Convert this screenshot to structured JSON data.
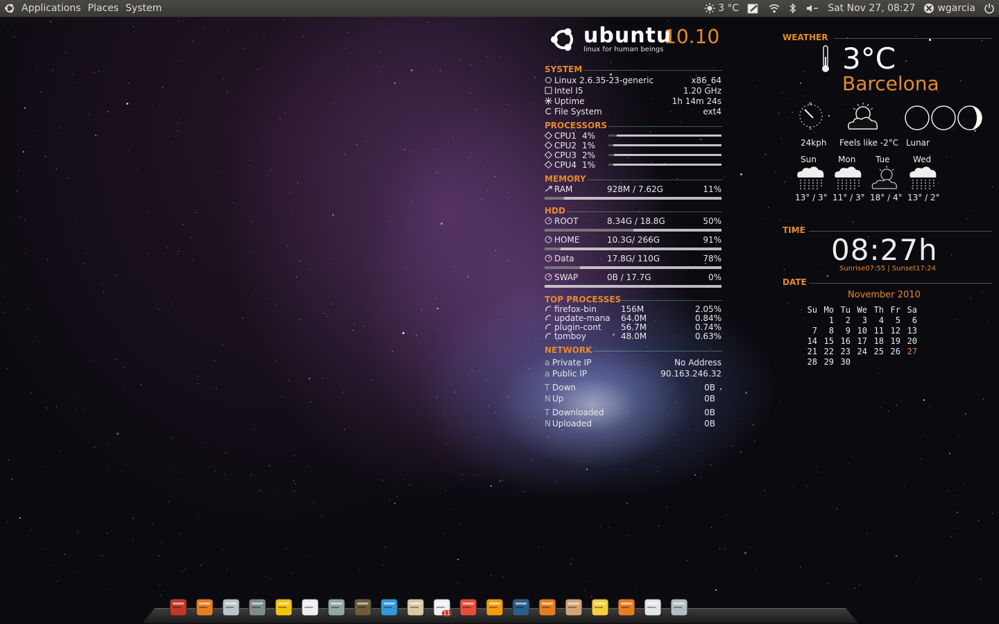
{
  "top_panel": {
    "menus": [
      "Applications",
      "Places",
      "System"
    ],
    "weather": "3 °C",
    "datetime": "Sat Nov 27, 08:27",
    "user": "wgarcia",
    "icons": [
      "ubuntu-logo-icon",
      "weather-icon",
      "notes-icon",
      "wifi-icon",
      "bluetooth-icon",
      "volume-icon",
      "user-icon",
      "power-icon"
    ]
  },
  "brand": {
    "word": "ubuntu",
    "version": "10.10",
    "tagline": "linux for human beings"
  },
  "system": {
    "title": "SYSTEM",
    "rows": [
      {
        "label": "Linux 2.6.35-23-generic",
        "value": "x86_64"
      },
      {
        "label": "Intel I5",
        "value": "1.20 GHz"
      },
      {
        "label": "Uptime",
        "value": "1h 14m 24s"
      },
      {
        "label": "File System",
        "value": "ext4"
      }
    ]
  },
  "processors": {
    "title": "PROCESSORS",
    "rows": [
      {
        "label": "CPU1",
        "value": "4%",
        "pct": 4
      },
      {
        "label": "CPU2",
        "value": "1%",
        "pct": 1
      },
      {
        "label": "CPU3",
        "value": "2%",
        "pct": 2
      },
      {
        "label": "CPU4",
        "value": "1%",
        "pct": 1
      }
    ]
  },
  "memory": {
    "title": "MEMORY",
    "label": "RAM",
    "used": "928M / 7.62G",
    "pct_text": "11%",
    "pct": 11
  },
  "hdd": {
    "title": "HDD",
    "rows": [
      {
        "label": "ROOT",
        "used": "8.34G / 18.8G",
        "pct_text": "50%",
        "pct": 50
      },
      {
        "label": "HOME",
        "used": "10.3G/ 266G",
        "pct_text": "91%",
        "pct": 9
      },
      {
        "label": "Data",
        "used": "17.8G/ 110G",
        "pct_text": "78%",
        "pct": 20
      },
      {
        "label": "SWAP",
        "used": "0B   / 17.7G",
        "pct_text": "0%",
        "pct": 0
      }
    ]
  },
  "top_processes": {
    "title": "TOP PROCESSES",
    "rows": [
      {
        "name": "firefox-bin",
        "mem": "156M",
        "cpu": "2.05%"
      },
      {
        "name": "update-mana",
        "mem": "64.0M",
        "cpu": "0.84%"
      },
      {
        "name": "plugin-cont",
        "mem": "56.7M",
        "cpu": "0.74%"
      },
      {
        "name": "tomboy",
        "mem": "48.0M",
        "cpu": "0.63%"
      }
    ]
  },
  "network": {
    "title": "NETWORK",
    "rows": [
      {
        "glyph": "a",
        "label": "Private IP",
        "value": "No Address"
      },
      {
        "glyph": "a",
        "label": "Public IP",
        "value": "90.163.246.32"
      },
      {
        "glyph": "T",
        "label": "Down",
        "value": "0B"
      },
      {
        "glyph": "N",
        "label": "Up",
        "value": "0B"
      },
      {
        "glyph": "T",
        "label": "Downloaded",
        "value": "0B"
      },
      {
        "glyph": "N",
        "label": "Uploaded",
        "value": "0B"
      }
    ]
  },
  "weather": {
    "title": "WEATHER",
    "temp": "3°C",
    "city": "Barcelona",
    "wind": "24kph",
    "feels": "Feels like -2°C",
    "lunar": "Lunar",
    "forecast": [
      {
        "day": "Sun",
        "range": "13° / 3°"
      },
      {
        "day": "Mon",
        "range": "11° / 3°"
      },
      {
        "day": "Tue",
        "range": "18° / 4°"
      },
      {
        "day": "Wed",
        "range": "13° / 2°"
      }
    ]
  },
  "time": {
    "title": "TIME",
    "clock": "08:27h",
    "sun": "Sunrise07:55 | Sunset17:24"
  },
  "date": {
    "title": "DATE",
    "month": "November 2010",
    "weekdays": [
      "Su",
      "Mo",
      "Tu",
      "We",
      "Th",
      "Fr",
      "Sa"
    ],
    "weeks": [
      [
        "",
        "1",
        "2",
        "3",
        "4",
        "5",
        "6"
      ],
      [
        "7",
        "8",
        "9",
        "10",
        "11",
        "12",
        "13"
      ],
      [
        "14",
        "15",
        "16",
        "17",
        "18",
        "19",
        "20"
      ],
      [
        "21",
        "22",
        "23",
        "24",
        "25",
        "26",
        "27"
      ],
      [
        "28",
        "29",
        "30",
        "",
        "",
        "",
        ""
      ]
    ],
    "today": "27"
  },
  "dock": {
    "badge": "11",
    "icons": [
      "terminal-icon",
      "firefox-icon",
      "calculator-icon",
      "tablet-icon",
      "image-viewer-icon",
      "text-editor-icon",
      "camera-icon",
      "gimp-icon",
      "phone-icon",
      "address-book-icon",
      "system-monitor-icon",
      "ruler-icon",
      "mail-icon",
      "activity-monitor-icon",
      "firefox-alt-icon",
      "folder-icon",
      "notes-icon",
      "home-icon",
      "window-icon",
      "trash-icon"
    ]
  }
}
